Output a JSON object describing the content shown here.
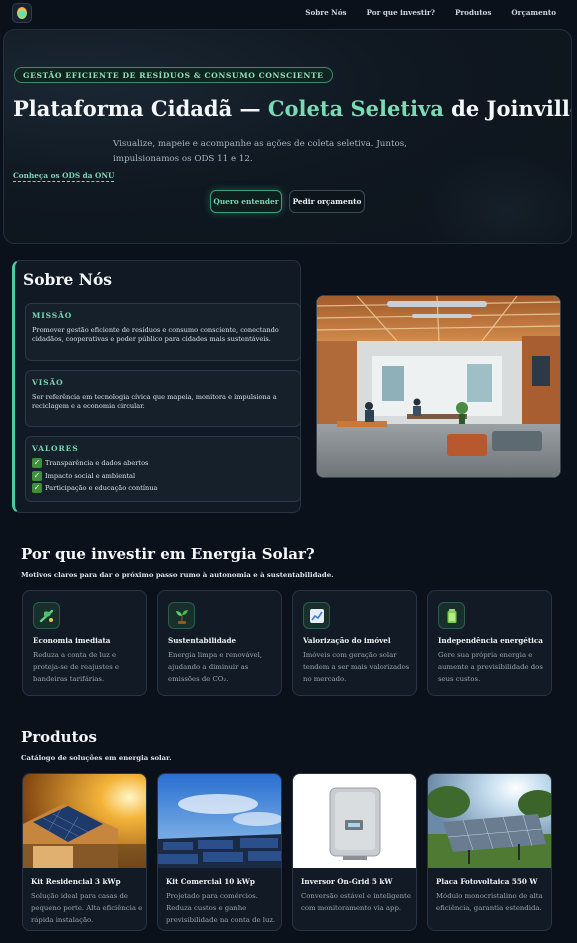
{
  "nav": {
    "links": [
      "Sobre Nós",
      "Por que investir?",
      "Produtos",
      "Orçamento"
    ]
  },
  "hero": {
    "badge": "GESTÃO EFICIENTE DE RESÍDUOS & CONSUMO CONSCIENTE",
    "title_part1": "Plataforma Cidadã — ",
    "title_accent": "Coleta Seletiva",
    "title_part2": " de Joinville",
    "description": "Visualize, mapeie e acompanhe as ações de coleta seletiva. Juntos, impulsionamos os ODS 11 e 12.",
    "ods_link": "Conheça os ODS da ONU",
    "primary_button": "Quero entender",
    "secondary_button": "Pedir orçamento"
  },
  "about": {
    "title": "Sobre Nós",
    "mission": {
      "title": "MISSÃO",
      "text": "Promover gestão eficiente de resíduos e consumo consciente, conectando cidadãos, cooperativas e poder público para cidades mais sustentáveis."
    },
    "vision": {
      "title": "VISÃO",
      "text": "Ser referência em tecnologia cívica que mapeia, monitora e impulsiona a reciclagem e a economia circular."
    },
    "values": {
      "title": "VALORES",
      "items": [
        "Transparência e dados abertos",
        "Impacto social e ambiental",
        "Participação e educação contínua"
      ]
    }
  },
  "why": {
    "title": "Por que investir em Energia Solar?",
    "subtitle": "Motivos claros para dar o próximo passo rumo à autonomia e à sustentabilidade.",
    "cards": [
      {
        "icon": "piggy-bank-icon",
        "title": "Economia imediata",
        "text": "Reduza a conta de luz e proteja-se de reajustes e bandeiras tarifárias."
      },
      {
        "icon": "seedling-icon",
        "title": "Sustentabilidade",
        "text": "Energia limpa e renovável, ajudando a diminuir as emissões de CO₂."
      },
      {
        "icon": "chart-up-icon",
        "title": "Valorização do imóvel",
        "text": "Imóveis com geração solar tendem a ser mais valorizados no mercado."
      },
      {
        "icon": "battery-icon",
        "title": "Independência energética",
        "text": "Gere sua própria energia e aumente a previsibilidade dos seus custos."
      }
    ]
  },
  "products": {
    "title": "Produtos",
    "subtitle": "Catálogo de soluções em energia solar.",
    "items": [
      {
        "title": "Kit Residencial 3 kWp",
        "text": "Solução ideal para casas de pequeno porte. Alta eficiência e rápida instalação."
      },
      {
        "title": "Kit Comercial 10 kWp",
        "text": "Projetado para comércios. Reduza custos e ganhe previsibilidade na conta de luz."
      },
      {
        "title": "Inversor On-Grid 5 kW",
        "text": "Conversão estável e inteligente com monitoramento via app."
      },
      {
        "title": "Placa Fotovoltaica 550 W",
        "text": "Módulo monocristalino de alta eficiência, garantia estendida."
      }
    ]
  }
}
